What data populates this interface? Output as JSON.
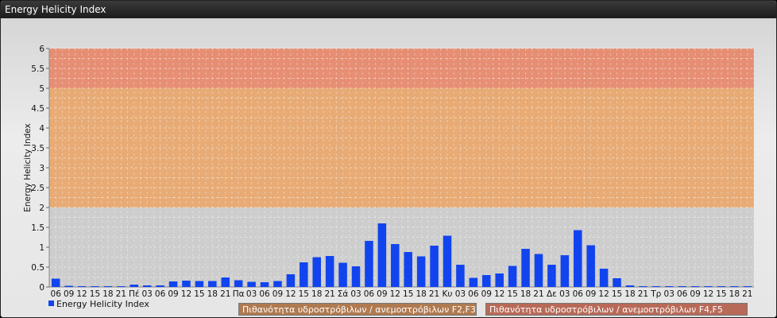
{
  "window": {
    "title": "Energy Helicity Index"
  },
  "chart_data": {
    "type": "bar",
    "ylabel": "Energy Helicity Index",
    "ylim": [
      0,
      6
    ],
    "yticks": [
      0,
      0.5,
      1,
      1.5,
      2,
      2.5,
      3,
      3.5,
      4,
      4.5,
      5,
      5.5,
      6
    ],
    "grid": true,
    "legend_position": "bottom-left",
    "categories": [
      "06",
      "09",
      "12",
      "15",
      "18",
      "21",
      "Πέ",
      "03",
      "06",
      "09",
      "12",
      "15",
      "18",
      "21",
      "Πα",
      "03",
      "06",
      "09",
      "12",
      "15",
      "18",
      "21",
      "Σά",
      "03",
      "06",
      "09",
      "12",
      "15",
      "18",
      "21",
      "Κυ",
      "03",
      "06",
      "09",
      "12",
      "15",
      "18",
      "21",
      "Δε",
      "03",
      "06",
      "09",
      "12",
      "15",
      "18",
      "21",
      "Τρ",
      "03",
      "06",
      "09",
      "12",
      "15",
      "18",
      "21"
    ],
    "series": [
      {
        "name": "Energy Helicity Index",
        "color": "#1144ee",
        "values": [
          0.21,
          0.03,
          0.02,
          0.02,
          0.02,
          0.02,
          0.06,
          0.04,
          0.04,
          0.14,
          0.16,
          0.15,
          0.15,
          0.24,
          0.17,
          0.13,
          0.12,
          0.15,
          0.32,
          0.62,
          0.75,
          0.78,
          0.61,
          0.52,
          1.16,
          1.6,
          1.08,
          0.88,
          0.77,
          1.04,
          1.29,
          0.56,
          0.23,
          0.3,
          0.34,
          0.53,
          0.96,
          0.83,
          0.56,
          0.8,
          1.43,
          1.05,
          0.46,
          0.22,
          0.04,
          0.02,
          0.02,
          0.02,
          0.02,
          0.02,
          0.02,
          0.02,
          0.02,
          0.02
        ]
      }
    ],
    "zones": [
      {
        "from": 0,
        "to": 2,
        "color": "#c8c8c8"
      },
      {
        "from": 2,
        "to": 5,
        "color": "#e8a060"
      },
      {
        "from": 5,
        "to": 6,
        "color": "#e88060"
      }
    ]
  },
  "zone_labels": [
    {
      "text": "Πιθανότητα υδροστρόβιλων / ανεμοστρόβιλων F2,F3",
      "color": "#b07a50"
    },
    {
      "text": "Πιθανότητα υδροστρόβιλων / ανεμοστρόβιλων F4,F5",
      "color": "#b86a58"
    }
  ]
}
